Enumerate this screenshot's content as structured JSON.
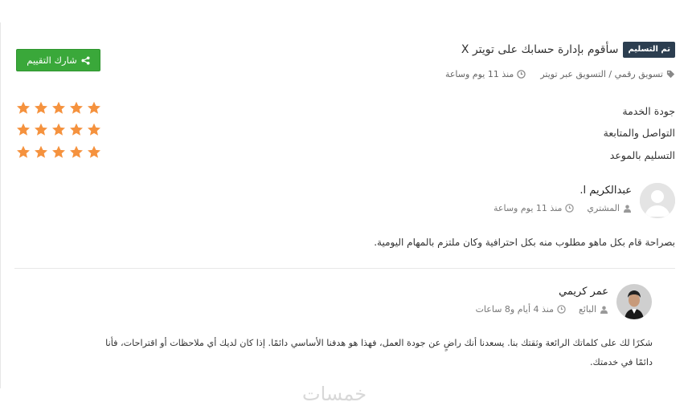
{
  "service": {
    "badge": "تم التسليم",
    "title": "سأقوم بإدارة حسابك على تويتر X",
    "category": "تسويق رقمي / التسويق عبر تويتر",
    "time": "منذ 11 يوم وساعة"
  },
  "share_button": {
    "label": "شارك التقييم",
    "color": "#3aa83a"
  },
  "ratings": [
    {
      "label": "جودة الخدمة",
      "stars": 5
    },
    {
      "label": "التواصل والمتابعة",
      "stars": 5
    },
    {
      "label": "التسليم بالموعد",
      "stars": 5
    }
  ],
  "buyer": {
    "name": "عبدالكريم ا.",
    "role": "المشتري",
    "time": "منذ 11 يوم وساعة",
    "comment": "بصراحة قام بكل ماهو مطلوب منه بكل احترافية وكان ملتزم بالمهام اليومية."
  },
  "seller": {
    "name": "عمر كريمي",
    "role": "البائع",
    "time": "منذ 4 أيام و8 ساعات",
    "reply_line1": "شكرًا لك على كلماتك الرائعة وثقتك بنا. يسعدنا أنك راضٍ عن جودة العمل، فهذا هو هدفنا الأساسي دائمًا. إذا كان لديك أي ملاحظات أو اقتراحات، فأنا",
    "reply_line2": "دائمًا في خدمتك."
  },
  "watermark": "خمسات",
  "colors": {
    "star": "#f5923e",
    "badge_bg": "#2c3e50",
    "accent_green": "#3aa83a"
  },
  "icons": [
    "tag-icon",
    "clock-icon",
    "share-icon",
    "user-icon",
    "star-icon"
  ]
}
